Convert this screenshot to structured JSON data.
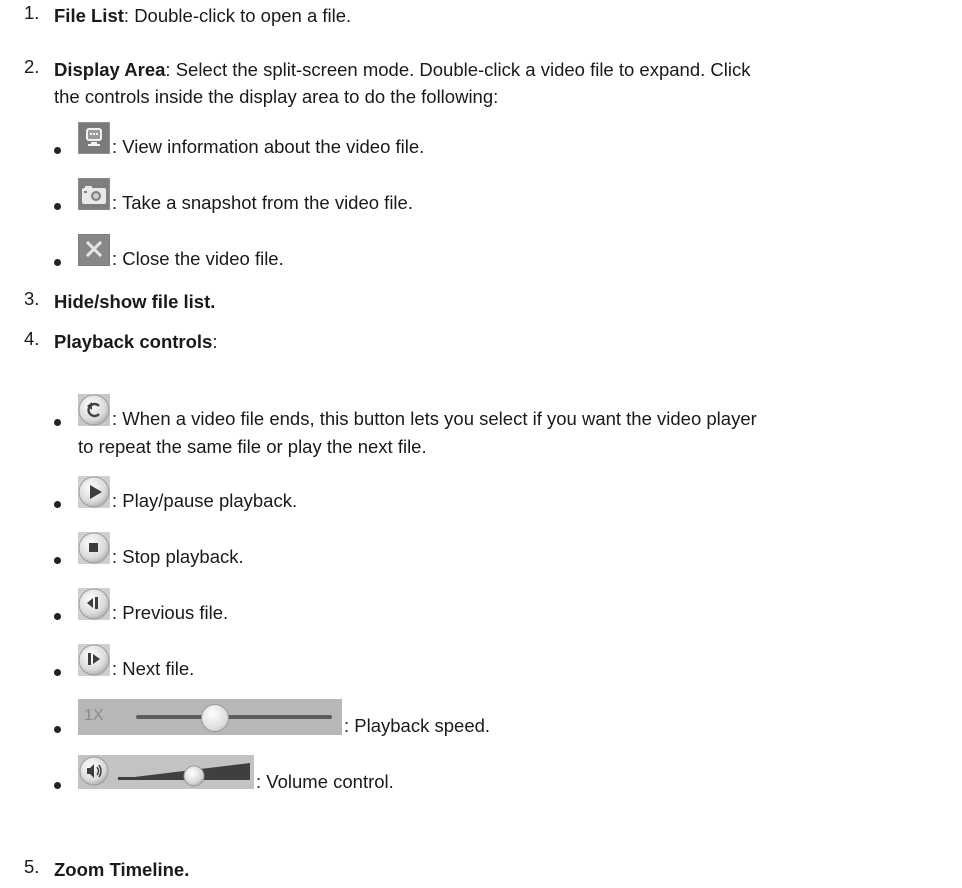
{
  "items": [
    {
      "num": "1.",
      "title": "File List",
      "sep": ": ",
      "desc": "Double-click to open a file."
    },
    {
      "num": "2.",
      "title": "Display Area",
      "sep": ": ",
      "desc_line1": "Select the split-screen mode. Double-click a video file to expand. Click",
      "desc_line2": "the controls inside the display area to do the following:"
    },
    {
      "num": "3.",
      "title": "Hide/show file list."
    },
    {
      "num": "4.",
      "title": "Playback controls",
      "sep": ":"
    },
    {
      "num": "5.",
      "title": "Zoom Timeline."
    }
  ],
  "display_controls": [
    {
      "icon": "info-icon",
      "text": ": View information about the video file."
    },
    {
      "icon": "camera-icon",
      "text": ": Take a snapshot from the video file."
    },
    {
      "icon": "close-icon",
      "text": ": Close the video file."
    }
  ],
  "playback_controls": [
    {
      "icon": "repeat-icon",
      "text_line1": ": When a video file ends, this button lets you select if you want the video player",
      "text_line2": "to repeat the same file or play the next file."
    },
    {
      "icon": "play-icon",
      "text": ": Play/pause playback."
    },
    {
      "icon": "stop-icon",
      "text": ": Stop playback."
    },
    {
      "icon": "previous-icon",
      "text": ": Previous file."
    },
    {
      "icon": "next-icon",
      "text": ": Next file."
    },
    {
      "icon": "speed-slider",
      "label": "1X",
      "text": ": Playback speed."
    },
    {
      "icon": "volume-slider",
      "text": ": Volume control."
    }
  ]
}
